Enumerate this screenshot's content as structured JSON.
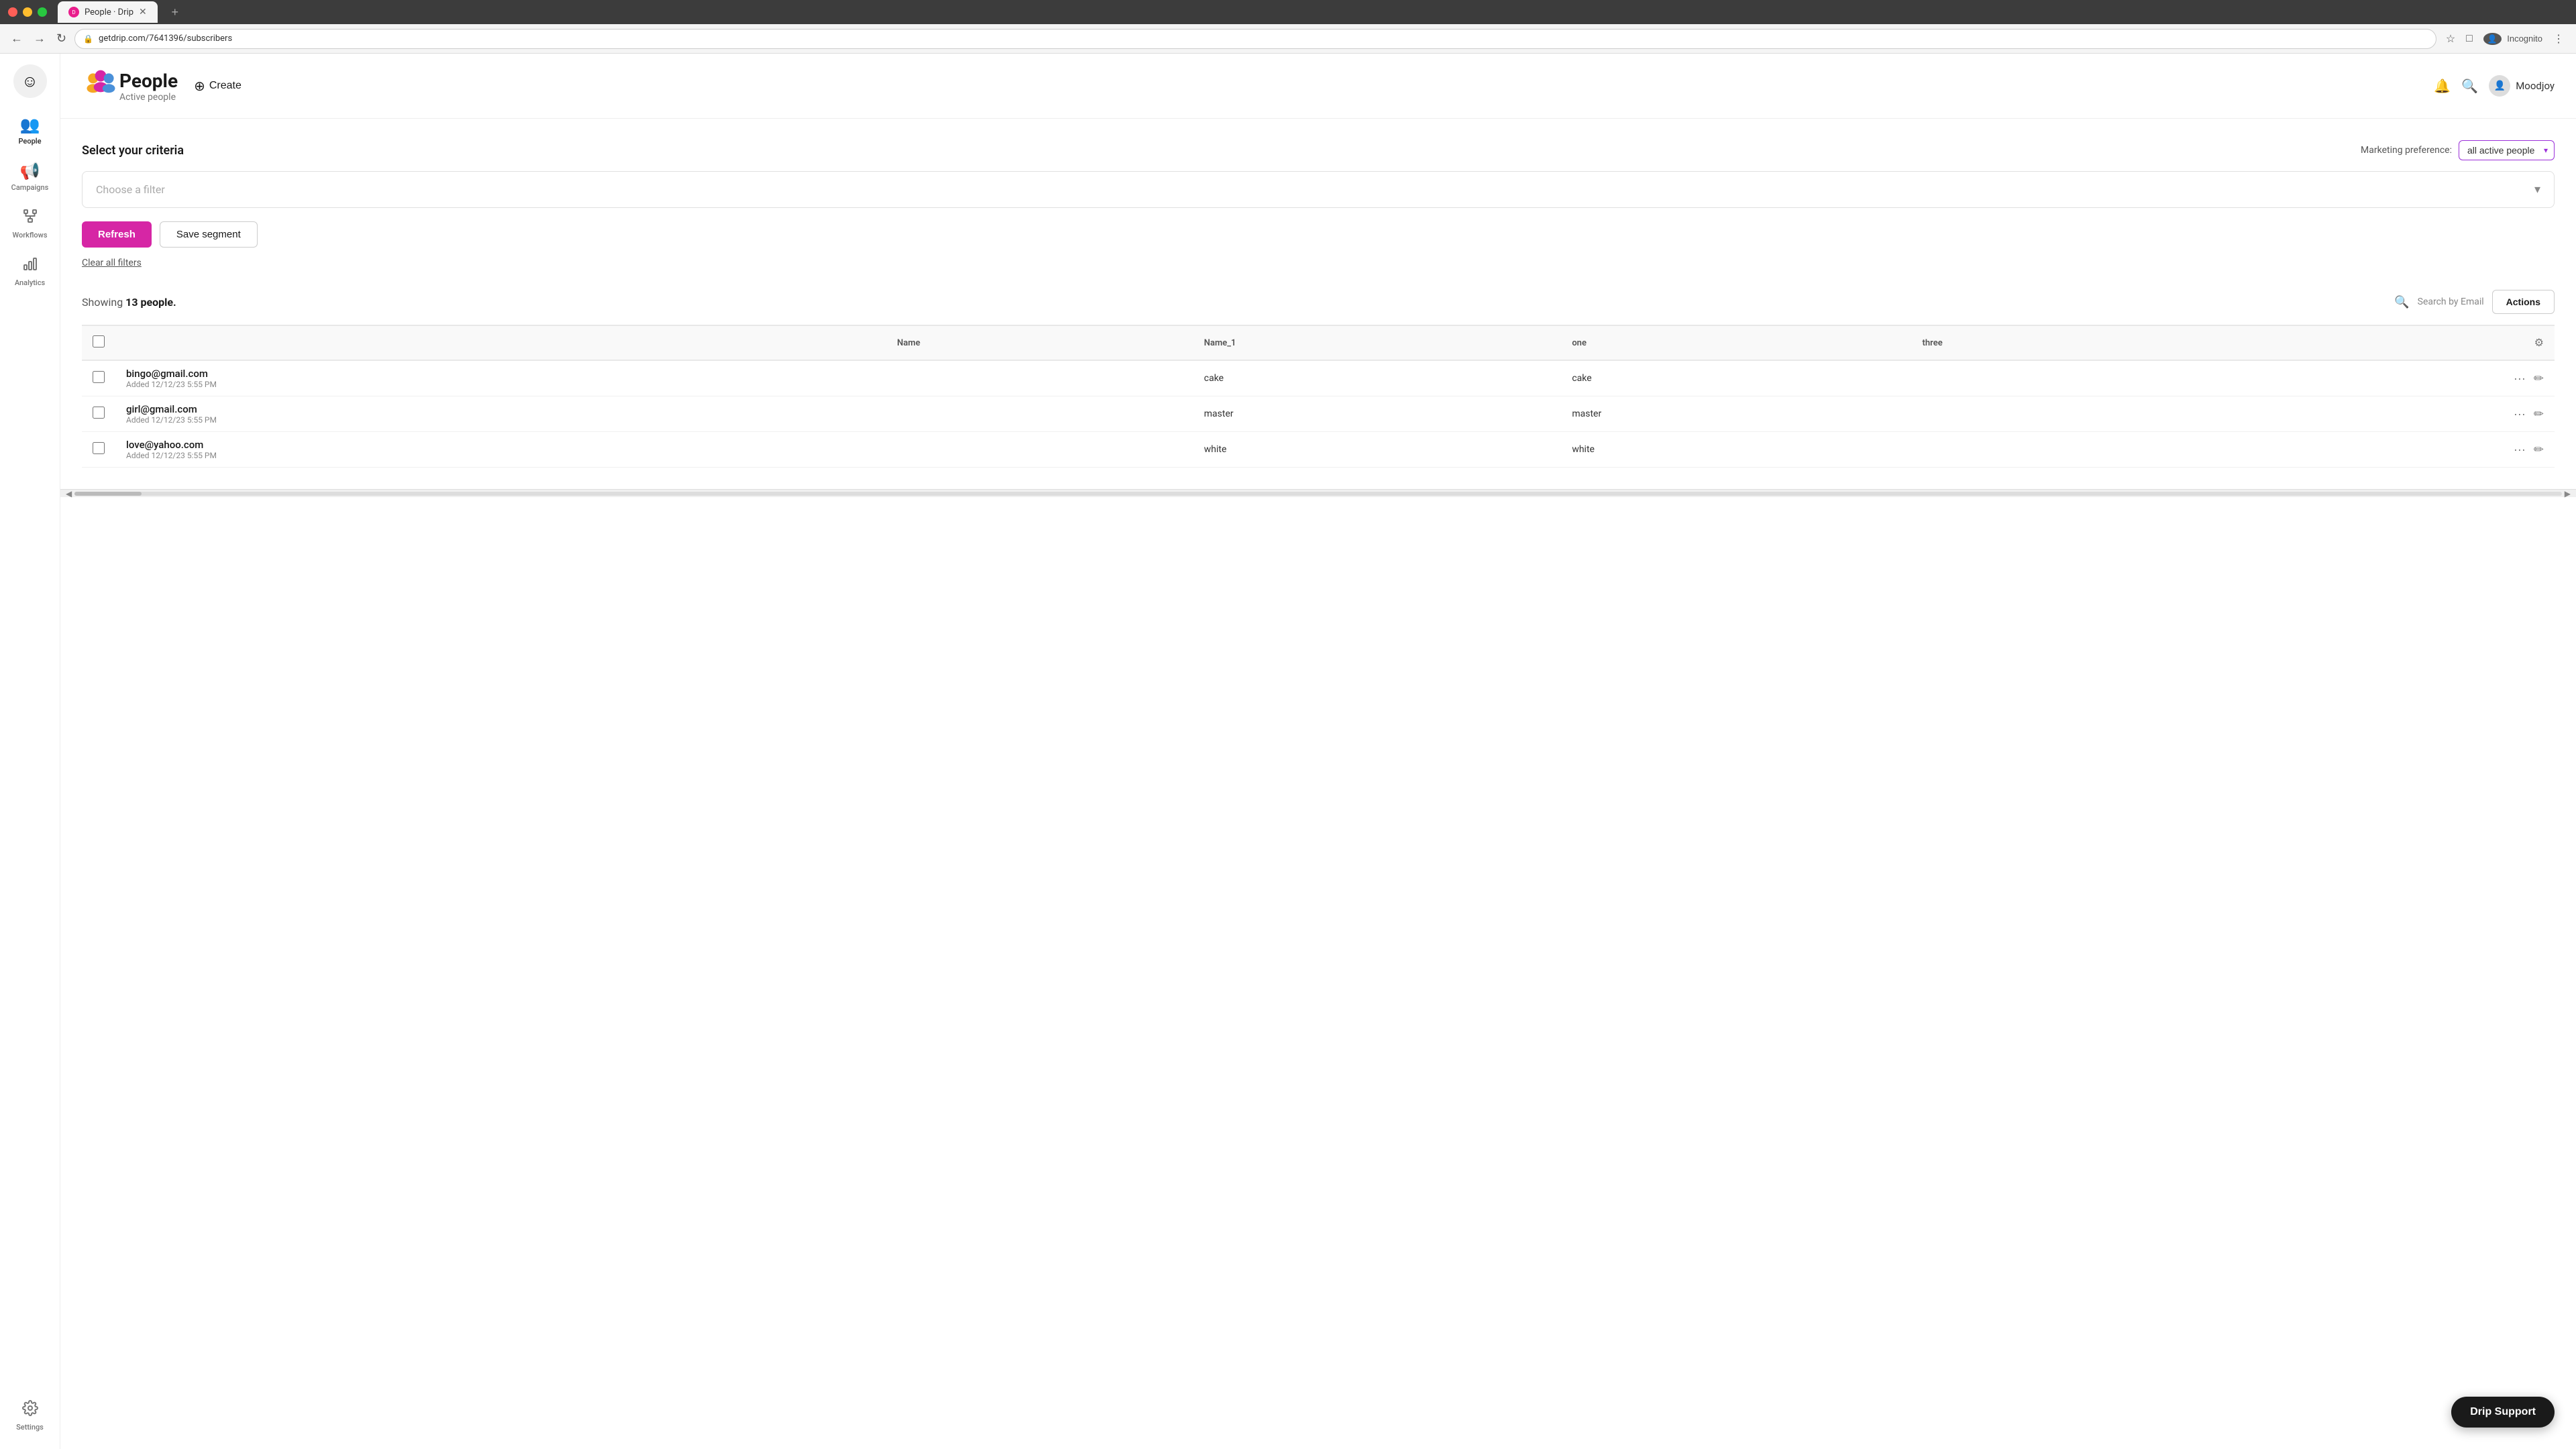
{
  "browser": {
    "tab_title": "People · Drip",
    "tab_new_label": "+",
    "url": "getdrip.com/7641396/subscribers",
    "nav": {
      "back": "←",
      "forward": "→",
      "reload": "↻"
    },
    "toolbar_icons": [
      "⭐",
      "□",
      "⋮"
    ],
    "user_label": "Incognito"
  },
  "sidebar": {
    "logo_emoji": "☺",
    "items": [
      {
        "id": "people",
        "label": "People",
        "icon": "👥",
        "active": true
      },
      {
        "id": "campaigns",
        "label": "Campaigns",
        "icon": "📢",
        "active": false
      },
      {
        "id": "workflows",
        "label": "Workflows",
        "icon": "⚙",
        "active": false
      },
      {
        "id": "analytics",
        "label": "Analytics",
        "icon": "📊",
        "active": false
      },
      {
        "id": "settings",
        "label": "Settings",
        "icon": "⚙",
        "active": false
      }
    ]
  },
  "header": {
    "title": "People",
    "subtitle": "Active people",
    "create_label": "Create",
    "notification_icon": "🔔",
    "search_icon": "🔍",
    "user_name": "Moodjoy",
    "user_avatar": "👤"
  },
  "criteria": {
    "section_title": "Select your criteria",
    "marketing_label": "Marketing preference:",
    "marketing_value": "all active people",
    "filter_placeholder": "Choose a filter",
    "filter_chevron": "▾",
    "refresh_label": "Refresh",
    "save_segment_label": "Save segment",
    "clear_filters_label": "Clear all filters"
  },
  "people_section": {
    "showing_prefix": "Showing",
    "showing_count": "13 people.",
    "search_placeholder": "Search by Email",
    "actions_label": "Actions",
    "table": {
      "columns": [
        {
          "id": "checkbox",
          "label": ""
        },
        {
          "id": "email",
          "label": ""
        },
        {
          "id": "name",
          "label": "Name"
        },
        {
          "id": "name1",
          "label": "Name_1"
        },
        {
          "id": "one",
          "label": "one"
        },
        {
          "id": "three",
          "label": "three"
        },
        {
          "id": "gear",
          "label": "⚙"
        }
      ],
      "rows": [
        {
          "email": "bingo@gmail.com",
          "added": "Added 12/12/23 5:55 PM",
          "name": "",
          "name1": "cake",
          "one": "cake",
          "three": ""
        },
        {
          "email": "girl@gmail.com",
          "added": "Added 12/12/23 5:55 PM",
          "name": "",
          "name1": "master",
          "one": "master",
          "three": ""
        },
        {
          "email": "love@yahoo.com",
          "added": "Added 12/12/23 5:55 PM",
          "name": "",
          "name1": "white",
          "one": "white",
          "three": ""
        }
      ]
    }
  },
  "drip_support": {
    "label": "Drip Support"
  }
}
